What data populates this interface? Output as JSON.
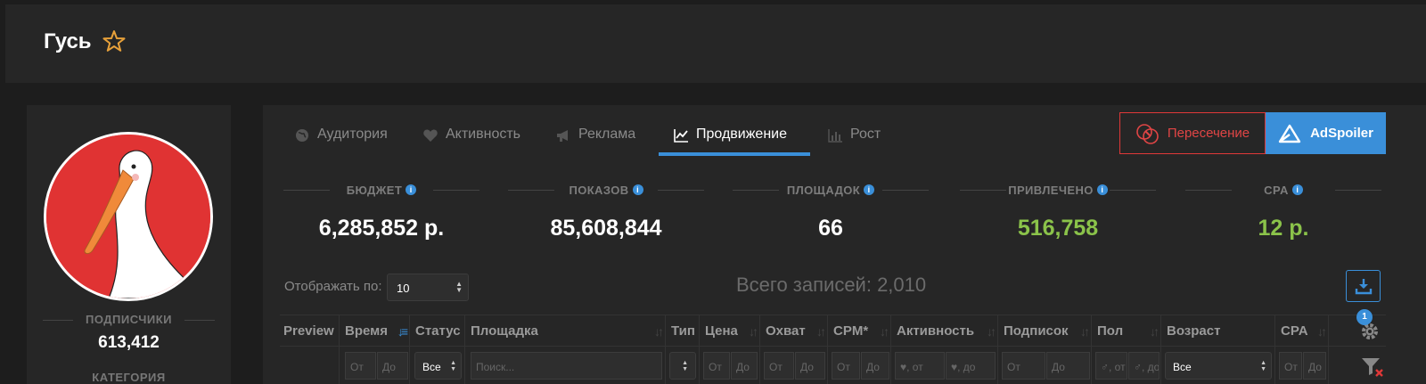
{
  "header": {
    "title": "Гусь"
  },
  "profile": {
    "subscribers_label": "ПОДПИСЧИКИ",
    "subscribers_value": "613,412",
    "category_label": "КАТЕГОРИЯ"
  },
  "tabs": [
    {
      "label": "Аудитория",
      "icon": "globe-icon"
    },
    {
      "label": "Активность",
      "icon": "heart-icon"
    },
    {
      "label": "Реклама",
      "icon": "megaphone-icon"
    },
    {
      "label": "Продвижение",
      "icon": "line-chart-icon",
      "active": true
    },
    {
      "label": "Рост",
      "icon": "bar-chart-icon"
    }
  ],
  "actions": {
    "intersect_label": "Пересечение",
    "adspoiler_label": "AdSpoiler"
  },
  "stats": [
    {
      "label": "БЮДЖЕТ",
      "value": "6,285,852 р."
    },
    {
      "label": "ПОКАЗОВ",
      "value": "85,608,844"
    },
    {
      "label": "ПЛОЩАДОК",
      "value": "66"
    },
    {
      "label": "ПРИВЛЕЧЕНО",
      "value": "516,758"
    },
    {
      "label": "CPA",
      "value": "12 р."
    }
  ],
  "controls": {
    "show_label": "Отображать по:",
    "show_value": "10",
    "total": "Всего записей: 2,010"
  },
  "table": {
    "columns": [
      "Preview",
      "Время",
      "Статус",
      "Площадка",
      "Тип",
      "Цена",
      "Охват",
      "CPM*",
      "Активность",
      "Подписок",
      "Пол",
      "Возраст",
      "CPA"
    ],
    "settings_badge": "1",
    "filters": {
      "time_from": "От",
      "time_to": "До",
      "status": "Все",
      "platform_search": "Поиск...",
      "price_from": "От",
      "price_to": "До",
      "reach_from": "От",
      "reach_to": "До",
      "cpm_from": "От",
      "cpm_to": "До",
      "activity_from": "♥, от",
      "activity_to": "♥, до",
      "subs_from": "От",
      "subs_to": "До",
      "sex_from": "♂, от",
      "sex_to": "♂, до",
      "age": "Все",
      "cpa_from": "От",
      "cpa_to": "До"
    }
  },
  "colors": {
    "accent": "#3a8fd9",
    "green": "#8bc34a",
    "red": "#e03838",
    "star": "#e8a13a"
  }
}
